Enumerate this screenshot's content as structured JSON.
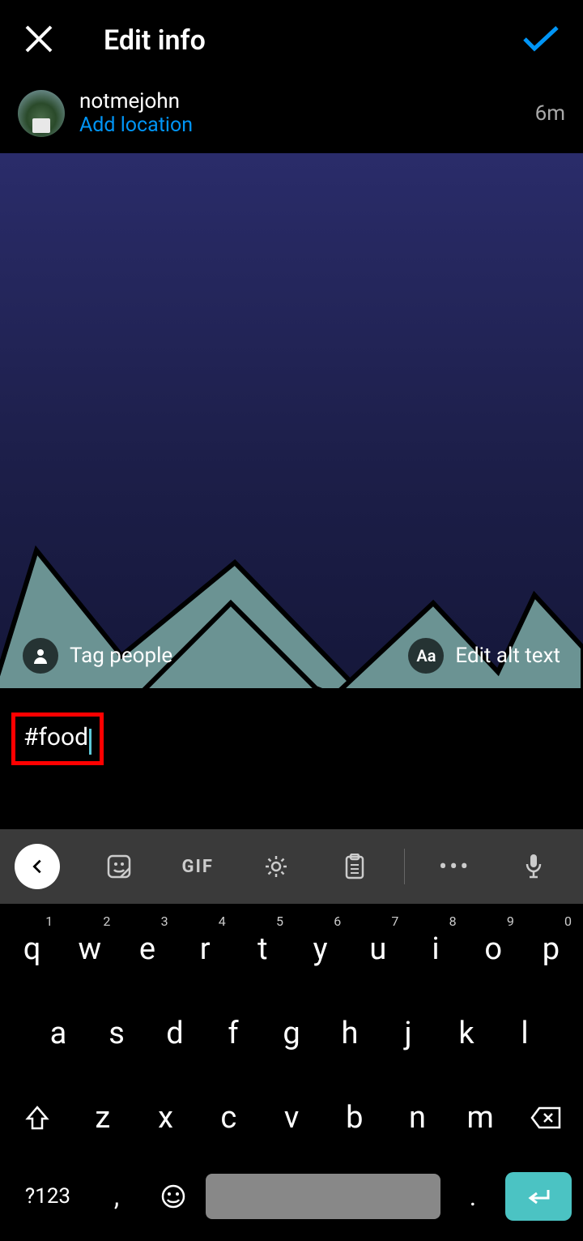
{
  "header": {
    "title": "Edit info"
  },
  "user": {
    "username": "notmejohn",
    "location_action": "Add location",
    "timestamp": "6m"
  },
  "overlays": {
    "tag_people": "Tag people",
    "edit_alt": "Edit alt text",
    "alt_icon_label": "Aa"
  },
  "caption": {
    "text": "#food"
  },
  "keyboard": {
    "gif_label": "GIF",
    "mode_label": "?123",
    "row1": [
      {
        "k": "q",
        "n": "1"
      },
      {
        "k": "w",
        "n": "2"
      },
      {
        "k": "e",
        "n": "3"
      },
      {
        "k": "r",
        "n": "4"
      },
      {
        "k": "t",
        "n": "5"
      },
      {
        "k": "y",
        "n": "6"
      },
      {
        "k": "u",
        "n": "7"
      },
      {
        "k": "i",
        "n": "8"
      },
      {
        "k": "o",
        "n": "9"
      },
      {
        "k": "p",
        "n": "0"
      }
    ],
    "row2": [
      "a",
      "s",
      "d",
      "f",
      "g",
      "h",
      "j",
      "k",
      "l"
    ],
    "row3": [
      "z",
      "x",
      "c",
      "v",
      "b",
      "n",
      "m"
    ],
    "comma": ",",
    "period": "."
  }
}
